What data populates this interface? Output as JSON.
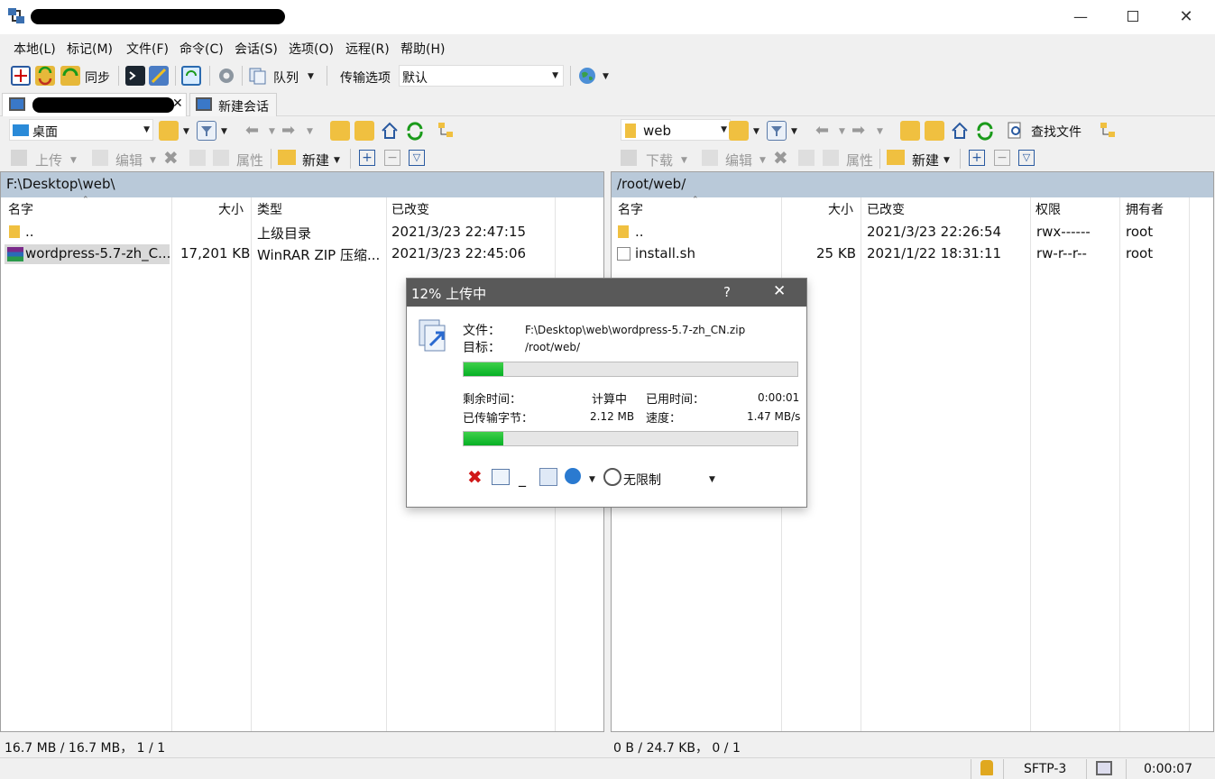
{
  "window": {
    "minimize_icon": "minimize-icon",
    "maximize_icon": "maximize-icon",
    "close_icon": "close-icon"
  },
  "menu": [
    "本地(L)",
    "标记(M)",
    "文件(F)",
    "命令(C)",
    "会话(S)",
    "选项(O)",
    "远程(R)",
    "帮助(H)"
  ],
  "toolbar": {
    "sync_label": "同步",
    "queue_label": "队列",
    "transfer_options_label": "传输选项",
    "transfer_preset": "默认"
  },
  "tabs": {
    "new_session_label": "新建会话"
  },
  "local": {
    "location": "桌面",
    "actions": {
      "upload": "上传",
      "edit": "编辑",
      "properties": "属性",
      "new": "新建"
    },
    "path": "F:\\Desktop\\web\\",
    "columns": [
      "名字",
      "大小",
      "类型",
      "已改变"
    ],
    "rows": [
      {
        "name": "..",
        "size": "",
        "type": "上级目录",
        "changed": "2021/3/23  22:47:15"
      },
      {
        "name": "wordpress-5.7-zh_C...",
        "size": "17,201 KB",
        "type": "WinRAR ZIP 压缩...",
        "changed": "2021/3/23  22:45:06"
      }
    ],
    "status": "16.7 MB / 16.7 MB，  1 / 1"
  },
  "remote": {
    "location": "web",
    "actions": {
      "download": "下载",
      "edit": "编辑",
      "properties": "属性",
      "new": "新建",
      "find": "查找文件"
    },
    "path": "/root/web/",
    "columns": [
      "名字",
      "大小",
      "已改变",
      "权限",
      "拥有者"
    ],
    "rows": [
      {
        "name": "..",
        "size": "",
        "changed": "2021/3/23 22:26:54",
        "rights": "rwx------",
        "owner": "root"
      },
      {
        "name": "install.sh",
        "size": "25 KB",
        "changed": "2021/1/22 18:31:11",
        "rights": "rw-r--r--",
        "owner": "root"
      }
    ],
    "status": "0 B / 24.7 KB，   0 / 1"
  },
  "dialog": {
    "title": "12% 上传中",
    "help": "?",
    "file_label": "文件：",
    "file_value": "F:\\Desktop\\web\\wordpress-5.7-zh_CN.zip",
    "target_label": "目标：",
    "target_value": "/root/web/",
    "file_progress": 0.12,
    "total_progress": 0.12,
    "remaining_label": "剩余时间：",
    "remaining_value": "计算中",
    "elapsed_label": "已用时间：",
    "elapsed_value": "0:00:01",
    "transferred_label": "已传输字节：",
    "transferred_value": "2.12 MB",
    "speed_label": "速度：",
    "speed_value": "1.47 MB/s",
    "speed_limit": "无限制",
    "minimize_glyph": "_"
  },
  "status": {
    "protocol": "SFTP-3",
    "time": "0:00:07"
  }
}
